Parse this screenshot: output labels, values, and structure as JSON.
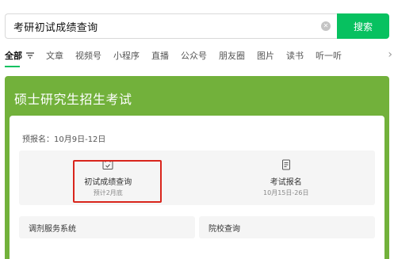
{
  "search": {
    "query": "考研初试成绩查询",
    "button_label": "搜索"
  },
  "tabs": [
    {
      "label": "全部",
      "active": true
    },
    {
      "label": "文章"
    },
    {
      "label": "视频号"
    },
    {
      "label": "小程序"
    },
    {
      "label": "直播"
    },
    {
      "label": "公众号"
    },
    {
      "label": "朋友圈"
    },
    {
      "label": "图片"
    },
    {
      "label": "读书"
    },
    {
      "label": "听一听"
    }
  ],
  "card": {
    "title": "硕士研究生招生考试",
    "pre_registration": "预报名：10月9日-12日",
    "grid": [
      {
        "label": "初试成绩查询",
        "sub": "预计2月底",
        "icon": "calendar-check-icon"
      },
      {
        "label": "考试报名",
        "sub": "10月15日-26日",
        "icon": "document-icon"
      }
    ],
    "links": [
      {
        "label": "调剂服务系统"
      },
      {
        "label": "院校查询"
      }
    ]
  },
  "colors": {
    "accent": "#07c160",
    "card_bg": "#72b13b",
    "highlight": "#d9251c"
  }
}
